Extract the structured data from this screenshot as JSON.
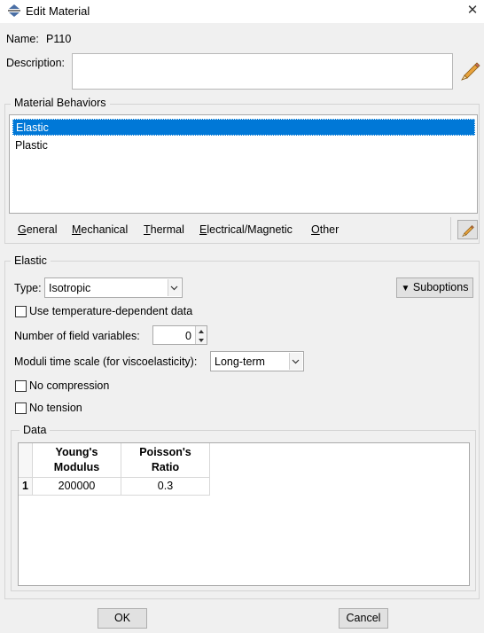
{
  "window": {
    "title": "Edit Material",
    "close_symbol": "✕"
  },
  "name": {
    "label": "Name:",
    "value": "P110"
  },
  "description": {
    "label": "Description:",
    "value": ""
  },
  "behaviors": {
    "title": "Material Behaviors",
    "items": [
      "Elastic",
      "Plastic"
    ],
    "selected": "Elastic"
  },
  "menus": {
    "general": {
      "mnemonic": "G",
      "rest": "eneral"
    },
    "mechanical": {
      "mnemonic": "M",
      "rest": "echanical"
    },
    "thermal": {
      "mnemonic": "T",
      "rest": "hermal"
    },
    "electrical": {
      "mnemonic": "E",
      "rest": "lectrical/Magnetic"
    },
    "other": {
      "mnemonic": "O",
      "rest": "ther"
    }
  },
  "elastic": {
    "title": "Elastic",
    "type_label": "Type:",
    "type_value": "Isotropic",
    "suboptions_label": "Suboptions",
    "temp_dependent": {
      "label": "Use temperature-dependent data",
      "checked": false
    },
    "field_vars": {
      "label": "Number of field variables:",
      "value": "0"
    },
    "moduli": {
      "label": "Moduli time scale (for viscoelasticity):",
      "value": "Long-term"
    },
    "no_compression": {
      "label": "No compression",
      "checked": false
    },
    "no_tension": {
      "label": "No tension",
      "checked": false
    }
  },
  "data": {
    "title": "Data",
    "columns": [
      {
        "line1": "Young's",
        "line2": "Modulus"
      },
      {
        "line1": "Poisson's",
        "line2": "Ratio"
      }
    ],
    "rows": [
      {
        "index": "1",
        "cells": [
          "200000",
          "0.3"
        ]
      }
    ]
  },
  "buttons": {
    "ok": "OK",
    "cancel": "Cancel"
  },
  "colors": {
    "selection": "#0078d7",
    "background": "#f0f0f0"
  }
}
